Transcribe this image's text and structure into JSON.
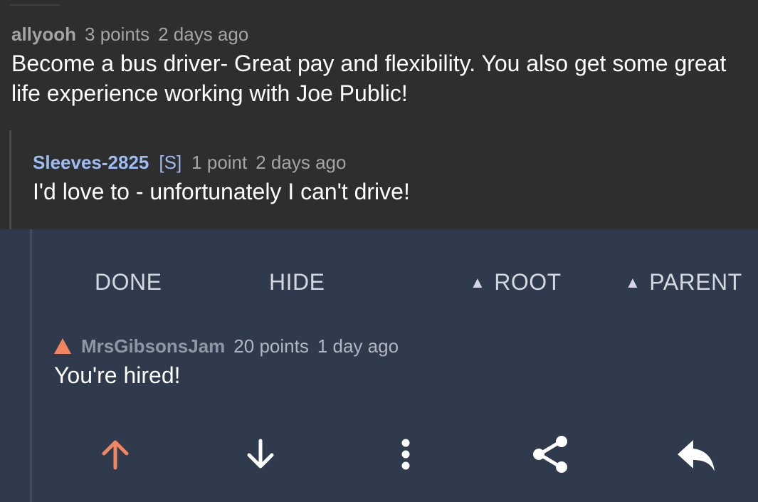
{
  "comments": [
    {
      "author": "allyooh",
      "points": "3 points",
      "age": "2 days ago",
      "body": "Become a bus driver- Great pay and flexibility. You also get some great life experience working with Joe Public!"
    },
    {
      "author": "Sleeves-2825",
      "op_tag": "[S]",
      "points": "1 point",
      "age": "2 days ago",
      "body": "I'd love to - unfortunately I can't drive!"
    }
  ],
  "actions": {
    "done": "DONE",
    "hide": "HIDE",
    "root": "ROOT",
    "parent": "PARENT",
    "up_glyph": "▲"
  },
  "selected": {
    "author": "MrsGibsonsJam",
    "points": "20 points",
    "age": "1 day ago",
    "body": "You're hired!",
    "vote_state": "upvoted"
  },
  "icons": [
    "arrow-up-icon",
    "arrow-down-icon",
    "more-vertical-icon",
    "share-icon",
    "reply-icon"
  ],
  "colors": {
    "background": "#2e2e2e",
    "selected_background": "#2f3b4c",
    "upvote": "#f0855f",
    "op_author": "#9cbcf2",
    "body_text": "#ffffff",
    "meta_text": "#a4a4a4"
  }
}
